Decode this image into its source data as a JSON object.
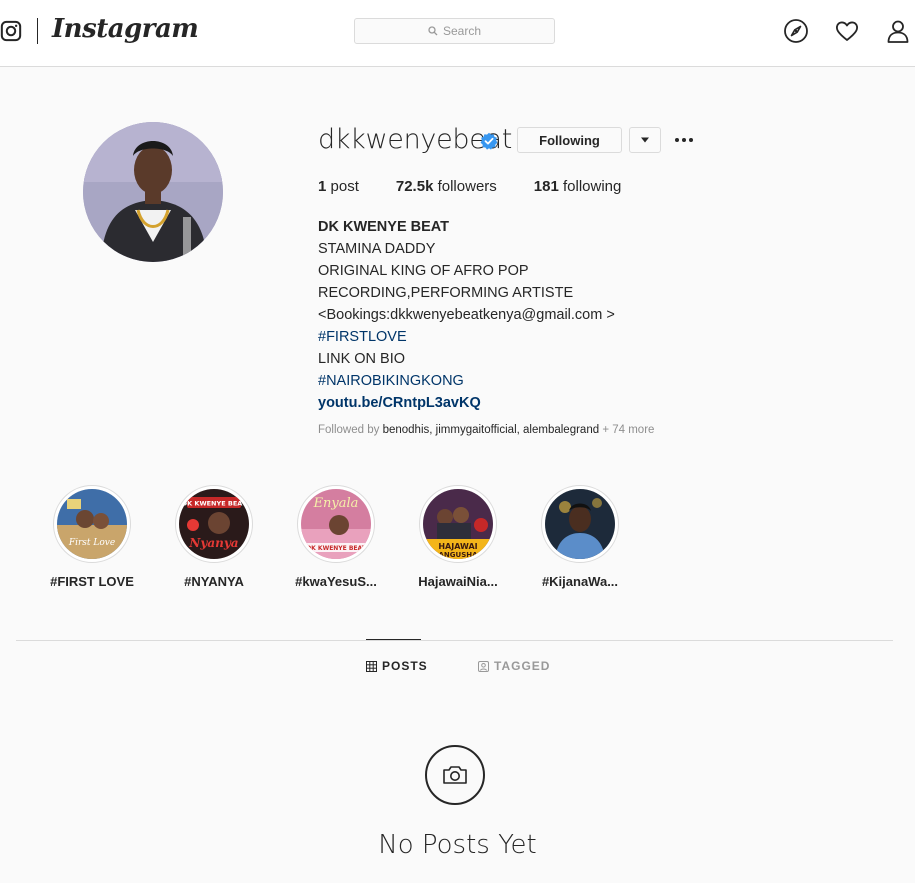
{
  "nav": {
    "wordmark": "Instagram",
    "search_placeholder": "Search"
  },
  "profile": {
    "username": "dkkwenyebeat",
    "following_button": "Following",
    "stats": {
      "posts_count": "1",
      "posts_label": "post",
      "followers_count": "72.5k",
      "followers_label": "followers",
      "following_count": "181",
      "following_label": "following"
    },
    "bio": {
      "name": "DK KWENYE BEAT",
      "lines": [
        "STAMINA DADDY",
        "ORIGINAL KING OF AFRO POP",
        "RECORDING,PERFORMING ARTISTE",
        "<Bookings:dkkwenyebeatkenya@gmail.com >"
      ],
      "hashtag1": "#FIRSTLOVE",
      "line_link_on_bio": "LINK ON BIO",
      "hashtag2": "#NAIROBIKINGKONG",
      "link": "youtu.be/CRntpL3avKQ"
    },
    "followed_by": {
      "prefix": "Followed by",
      "users": [
        "benodhis",
        "jimmygaitofficial",
        "alembalegrand"
      ],
      "more": "+ 74 more"
    }
  },
  "highlights": [
    {
      "label": "#FIRST LOVE"
    },
    {
      "label": "#NYANYA"
    },
    {
      "label": "#kwaYesuS..."
    },
    {
      "label": "HajawaiNia..."
    },
    {
      "label": "#KijanaWa..."
    }
  ],
  "tabs": {
    "posts": "POSTS",
    "tagged": "TAGGED"
  },
  "empty_state": {
    "title": "No Posts Yet"
  },
  "colors": {
    "verified_blue": "#3897f0",
    "hashtag_link": "#003569",
    "border": "#dbdbdb"
  }
}
